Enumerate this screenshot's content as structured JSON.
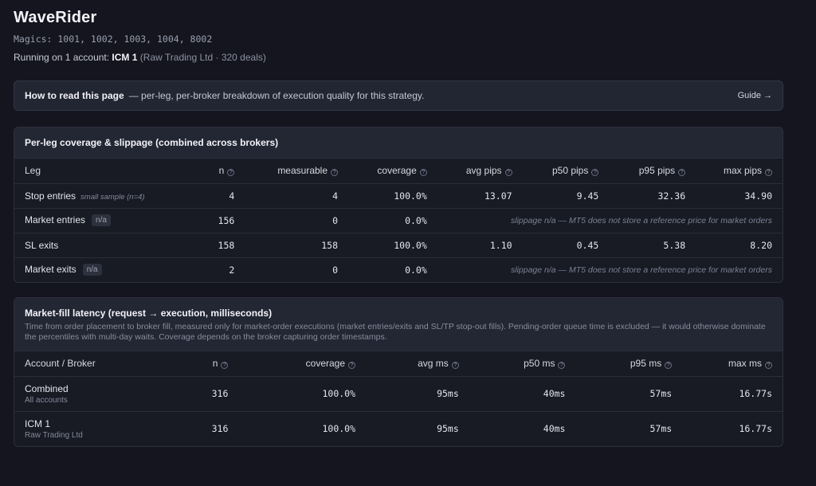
{
  "header": {
    "title": "WaveRider",
    "magics": "Magics: 1001, 1002, 1003, 1004, 8002",
    "running_prefix": "Running on 1 account: ",
    "running_account": "ICM 1",
    "running_detail": "(Raw Trading Ltd · 320 deals)"
  },
  "howto": {
    "heading": "How to read this page",
    "text": "— per-leg, per-broker breakdown of execution quality for this strategy.",
    "guide_label": "Guide →"
  },
  "coverage": {
    "title": "Per-leg coverage & slippage (combined across brokers)",
    "columns": [
      "Leg",
      "n",
      "measurable",
      "coverage",
      "avg pips",
      "p50 pips",
      "p95 pips",
      "max pips"
    ],
    "rows": [
      {
        "leg": "Stop entries",
        "tag": "small sample (n=4)",
        "n": "4",
        "measurable": "4",
        "coverage": "100.0%",
        "avg": "13.07",
        "p50": "9.45",
        "p95": "32.36",
        "max": "34.90"
      },
      {
        "leg": "Market entries",
        "badge": "n/a",
        "n": "156",
        "measurable": "0",
        "coverage": "0.0%",
        "note": "slippage n/a — MT5 does not store a reference price for market orders"
      },
      {
        "leg": "SL exits",
        "n": "158",
        "measurable": "158",
        "coverage": "100.0%",
        "avg": "1.10",
        "p50": "0.45",
        "p95": "5.38",
        "max": "8.20"
      },
      {
        "leg": "Market exits",
        "badge": "n/a",
        "n": "2",
        "measurable": "0",
        "coverage": "0.0%",
        "note": "slippage n/a — MT5 does not store a reference price for market orders"
      }
    ]
  },
  "latency": {
    "title": "Market-fill latency (request → execution, milliseconds)",
    "description": "Time from order placement to broker fill, measured only for market-order executions (market entries/exits and SL/TP stop-out fills). Pending-order queue time is excluded — it would otherwise dominate the percentiles with multi-day waits. Coverage depends on the broker capturing order timestamps.",
    "columns": [
      "Account / Broker",
      "n",
      "coverage",
      "avg ms",
      "p50 ms",
      "p95 ms",
      "max ms"
    ],
    "rows": [
      {
        "name": "Combined",
        "sub": "All accounts",
        "n": "316",
        "coverage": "100.0%",
        "avg": "95ms",
        "p50": "40ms",
        "p95": "57ms",
        "max": "16.77s"
      },
      {
        "name": "ICM 1",
        "sub": "Raw Trading Ltd",
        "n": "316",
        "coverage": "100.0%",
        "avg": "95ms",
        "p50": "40ms",
        "p95": "57ms",
        "max": "16.77s"
      }
    ]
  },
  "colors": {
    "background": "#14151e",
    "card": "#181a24",
    "card_header": "#232633"
  }
}
